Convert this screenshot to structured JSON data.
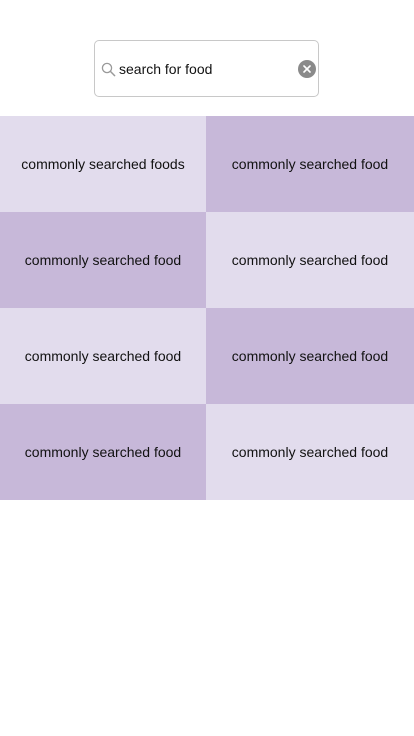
{
  "search": {
    "value": "search for food",
    "placeholder": "search for food"
  },
  "icons": {
    "search": "search-icon",
    "clear": "clear-icon"
  },
  "colors": {
    "tile_light": "#e2dced",
    "tile_dark": "#c7b8d9",
    "clear_button": "#8a8a8a"
  },
  "foods": [
    {
      "label": "commonly searched foods"
    },
    {
      "label": "commonly searched food"
    },
    {
      "label": "commonly searched food"
    },
    {
      "label": "commonly searched food"
    },
    {
      "label": "commonly searched food"
    },
    {
      "label": "commonly searched food"
    },
    {
      "label": "commonly searched food"
    },
    {
      "label": "commonly searched food"
    }
  ]
}
